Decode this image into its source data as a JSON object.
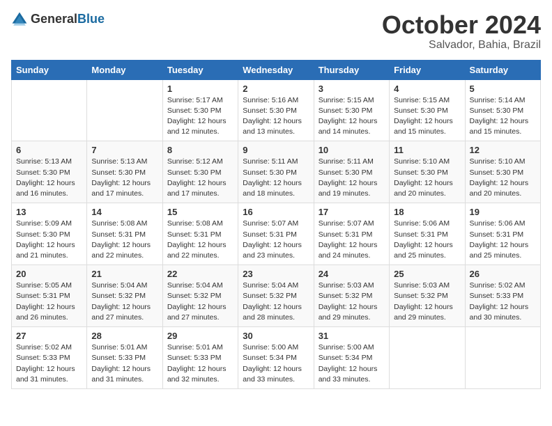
{
  "logo": {
    "general": "General",
    "blue": "Blue"
  },
  "header": {
    "month": "October 2024",
    "location": "Salvador, Bahia, Brazil"
  },
  "weekdays": [
    "Sunday",
    "Monday",
    "Tuesday",
    "Wednesday",
    "Thursday",
    "Friday",
    "Saturday"
  ],
  "weeks": [
    [
      {
        "day": "",
        "info": ""
      },
      {
        "day": "",
        "info": ""
      },
      {
        "day": "1",
        "info": "Sunrise: 5:17 AM\nSunset: 5:30 PM\nDaylight: 12 hours\nand 12 minutes."
      },
      {
        "day": "2",
        "info": "Sunrise: 5:16 AM\nSunset: 5:30 PM\nDaylight: 12 hours\nand 13 minutes."
      },
      {
        "day": "3",
        "info": "Sunrise: 5:15 AM\nSunset: 5:30 PM\nDaylight: 12 hours\nand 14 minutes."
      },
      {
        "day": "4",
        "info": "Sunrise: 5:15 AM\nSunset: 5:30 PM\nDaylight: 12 hours\nand 15 minutes."
      },
      {
        "day": "5",
        "info": "Sunrise: 5:14 AM\nSunset: 5:30 PM\nDaylight: 12 hours\nand 15 minutes."
      }
    ],
    [
      {
        "day": "6",
        "info": "Sunrise: 5:13 AM\nSunset: 5:30 PM\nDaylight: 12 hours\nand 16 minutes."
      },
      {
        "day": "7",
        "info": "Sunrise: 5:13 AM\nSunset: 5:30 PM\nDaylight: 12 hours\nand 17 minutes."
      },
      {
        "day": "8",
        "info": "Sunrise: 5:12 AM\nSunset: 5:30 PM\nDaylight: 12 hours\nand 17 minutes."
      },
      {
        "day": "9",
        "info": "Sunrise: 5:11 AM\nSunset: 5:30 PM\nDaylight: 12 hours\nand 18 minutes."
      },
      {
        "day": "10",
        "info": "Sunrise: 5:11 AM\nSunset: 5:30 PM\nDaylight: 12 hours\nand 19 minutes."
      },
      {
        "day": "11",
        "info": "Sunrise: 5:10 AM\nSunset: 5:30 PM\nDaylight: 12 hours\nand 20 minutes."
      },
      {
        "day": "12",
        "info": "Sunrise: 5:10 AM\nSunset: 5:30 PM\nDaylight: 12 hours\nand 20 minutes."
      }
    ],
    [
      {
        "day": "13",
        "info": "Sunrise: 5:09 AM\nSunset: 5:30 PM\nDaylight: 12 hours\nand 21 minutes."
      },
      {
        "day": "14",
        "info": "Sunrise: 5:08 AM\nSunset: 5:31 PM\nDaylight: 12 hours\nand 22 minutes."
      },
      {
        "day": "15",
        "info": "Sunrise: 5:08 AM\nSunset: 5:31 PM\nDaylight: 12 hours\nand 22 minutes."
      },
      {
        "day": "16",
        "info": "Sunrise: 5:07 AM\nSunset: 5:31 PM\nDaylight: 12 hours\nand 23 minutes."
      },
      {
        "day": "17",
        "info": "Sunrise: 5:07 AM\nSunset: 5:31 PM\nDaylight: 12 hours\nand 24 minutes."
      },
      {
        "day": "18",
        "info": "Sunrise: 5:06 AM\nSunset: 5:31 PM\nDaylight: 12 hours\nand 25 minutes."
      },
      {
        "day": "19",
        "info": "Sunrise: 5:06 AM\nSunset: 5:31 PM\nDaylight: 12 hours\nand 25 minutes."
      }
    ],
    [
      {
        "day": "20",
        "info": "Sunrise: 5:05 AM\nSunset: 5:31 PM\nDaylight: 12 hours\nand 26 minutes."
      },
      {
        "day": "21",
        "info": "Sunrise: 5:04 AM\nSunset: 5:32 PM\nDaylight: 12 hours\nand 27 minutes."
      },
      {
        "day": "22",
        "info": "Sunrise: 5:04 AM\nSunset: 5:32 PM\nDaylight: 12 hours\nand 27 minutes."
      },
      {
        "day": "23",
        "info": "Sunrise: 5:04 AM\nSunset: 5:32 PM\nDaylight: 12 hours\nand 28 minutes."
      },
      {
        "day": "24",
        "info": "Sunrise: 5:03 AM\nSunset: 5:32 PM\nDaylight: 12 hours\nand 29 minutes."
      },
      {
        "day": "25",
        "info": "Sunrise: 5:03 AM\nSunset: 5:32 PM\nDaylight: 12 hours\nand 29 minutes."
      },
      {
        "day": "26",
        "info": "Sunrise: 5:02 AM\nSunset: 5:33 PM\nDaylight: 12 hours\nand 30 minutes."
      }
    ],
    [
      {
        "day": "27",
        "info": "Sunrise: 5:02 AM\nSunset: 5:33 PM\nDaylight: 12 hours\nand 31 minutes."
      },
      {
        "day": "28",
        "info": "Sunrise: 5:01 AM\nSunset: 5:33 PM\nDaylight: 12 hours\nand 31 minutes."
      },
      {
        "day": "29",
        "info": "Sunrise: 5:01 AM\nSunset: 5:33 PM\nDaylight: 12 hours\nand 32 minutes."
      },
      {
        "day": "30",
        "info": "Sunrise: 5:00 AM\nSunset: 5:34 PM\nDaylight: 12 hours\nand 33 minutes."
      },
      {
        "day": "31",
        "info": "Sunrise: 5:00 AM\nSunset: 5:34 PM\nDaylight: 12 hours\nand 33 minutes."
      },
      {
        "day": "",
        "info": ""
      },
      {
        "day": "",
        "info": ""
      }
    ]
  ]
}
